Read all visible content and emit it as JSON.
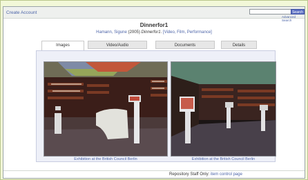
{
  "header": {
    "create_account": "Create Account",
    "search_placeholder": "",
    "search_label": "Search",
    "advanced_search": "Advanced Search"
  },
  "record": {
    "title": "Dinnerfor1",
    "creators": "Hamann, Sigune",
    "year": "(2005)",
    "work_title": "Dinnerfor1",
    "types": "[Video, Film, Performance]"
  },
  "tabs": [
    {
      "label": "Images",
      "active": true
    },
    {
      "label": "Video/Audio",
      "active": false
    },
    {
      "label": "Documents",
      "active": false
    },
    {
      "label": "Details",
      "active": false
    }
  ],
  "images": [
    {
      "caption": "Exhibition at the British Council Berlin"
    },
    {
      "caption": "Exhibition at the British Council Berlin"
    }
  ],
  "staff": {
    "prefix": "Repository Staff Only:",
    "link": "item control page"
  },
  "colors": {
    "link": "#4c64a8",
    "frame_bg": "#f2f8d8",
    "panel_bg": "#eef0f8",
    "button_bg": "#5a6ec2"
  }
}
